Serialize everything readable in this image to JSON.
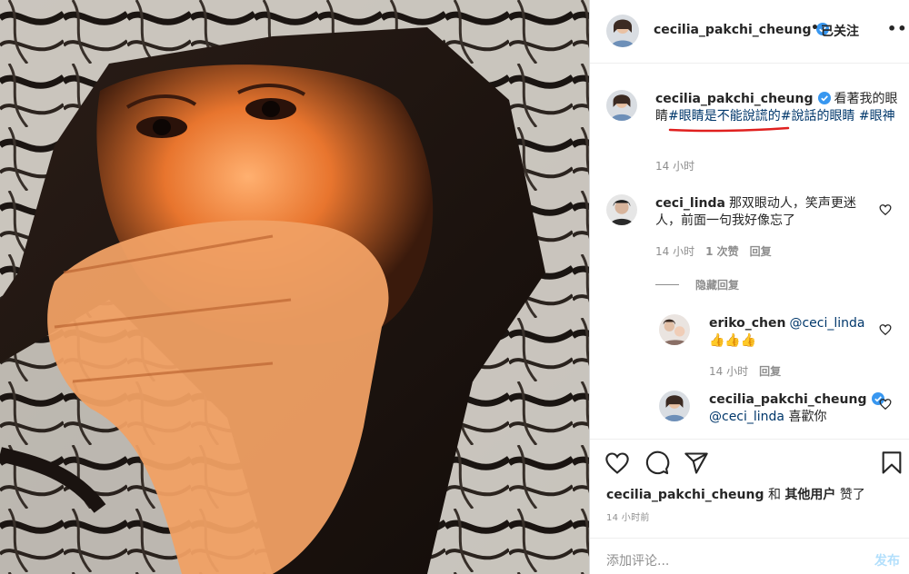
{
  "post": {
    "author": "cecilia_pakchi_cheung",
    "follow_state": "已关注",
    "dot": "•",
    "more": "•••"
  },
  "caption": {
    "user": "cecilia_pakchi_cheung",
    "text": "看著我的眼睛",
    "tags": [
      "#眼睛是不能說謊的",
      "#說話的眼睛",
      "#眼神"
    ],
    "time": "14 小时"
  },
  "comments": [
    {
      "user": "ceci_linda",
      "text": "那双眼动人，笑声更迷人，前面一句我好像忘了",
      "time": "14 小时",
      "likes": "1 次赞",
      "reply": "回复"
    }
  ],
  "hide_replies": "隐藏回复",
  "replies": [
    {
      "user": "eriko_chen",
      "mention": "@ceci_linda",
      "text": "👍👍👍",
      "time": "14 小时",
      "reply": "回复"
    },
    {
      "user": "cecilia_pakchi_cheung",
      "mention": "@ceci_linda",
      "text": "喜歡你"
    }
  ],
  "actions": {
    "liked_by_user": "cecilia_pakchi_cheung",
    "liked_and": "和",
    "liked_others": "其他用户",
    "liked_suffix": "赞了",
    "time_ago": "14 小时前"
  },
  "add_comment": {
    "placeholder": "添加评论...",
    "post_label": "发布"
  },
  "icons": {
    "like": "heart-icon",
    "comment": "comment-icon",
    "share": "share-icon",
    "save": "bookmark-icon",
    "verified": "verified-badge-icon",
    "options": "more-options-icon"
  },
  "colors": {
    "link": "#00376b",
    "verified": "#3897f0",
    "muted": "#8e8e8e",
    "post_disabled": "#b2dffc",
    "annotation": "#e0201f"
  }
}
